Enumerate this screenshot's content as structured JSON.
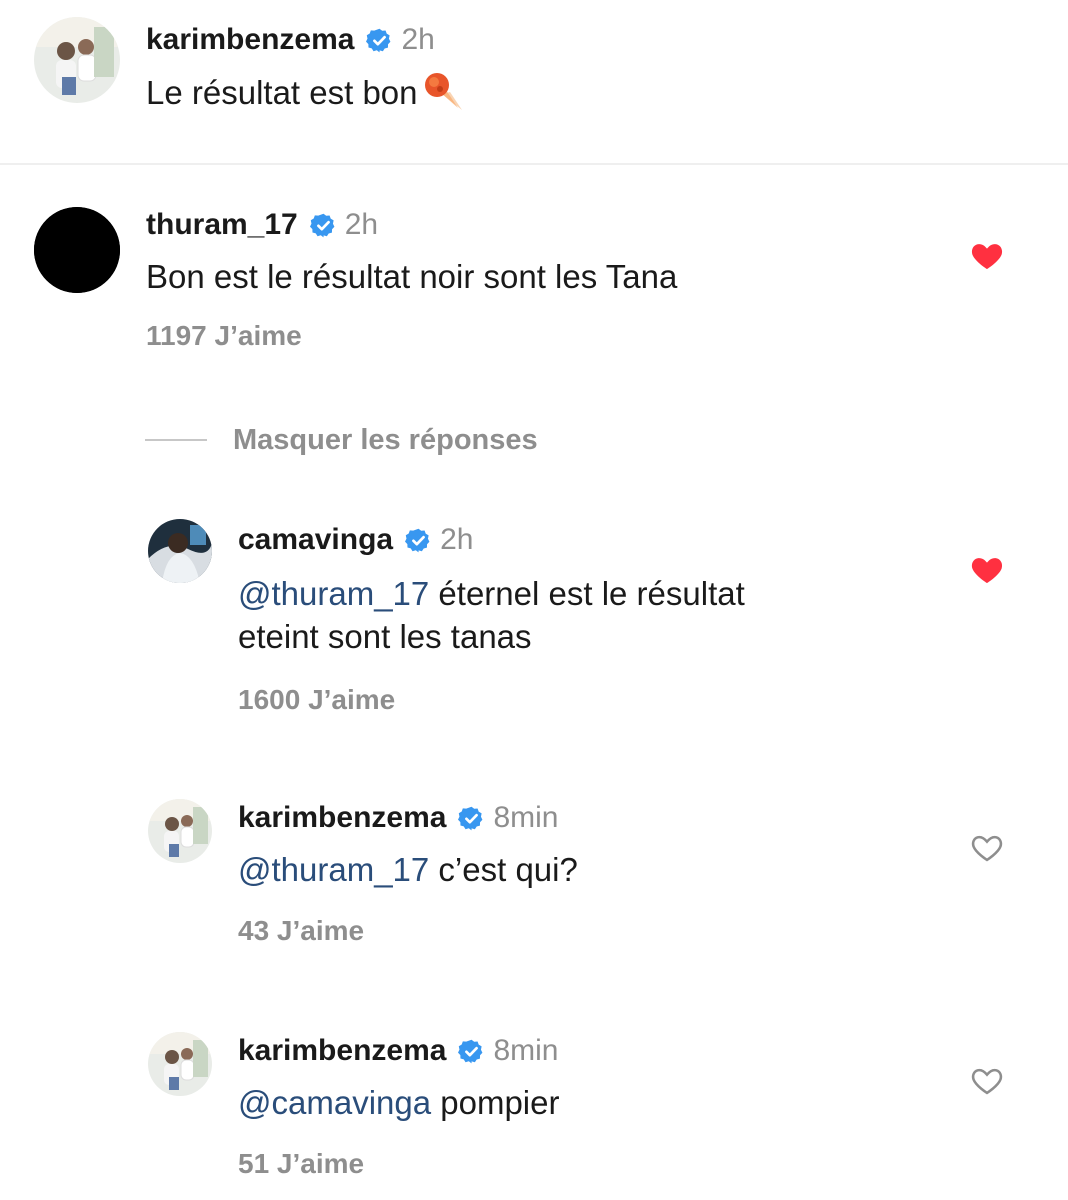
{
  "comments": [
    {
      "username": "karimbenzema",
      "time": "2h",
      "text": "Le résultat est bon",
      "emoji": "meteor-emoji"
    },
    {
      "username": "thuram_17",
      "time": "2h",
      "text": "Bon est le résultat noir sont les Tana",
      "likes": "1197 J’aime",
      "liked": true
    }
  ],
  "replies_toggle": "Masquer les réponses",
  "replies": [
    {
      "username": "camavinga",
      "time": "2h",
      "mention": "@thuram_17",
      "text": " éternel est le résultat",
      "text_line2": "eteint sont les tanas",
      "likes": "1600 J’aime",
      "liked": true
    },
    {
      "username": "karimbenzema",
      "time": "8min",
      "mention": "@thuram_17",
      "text": " c’est qui?",
      "likes": "43 J’aime",
      "liked": false
    },
    {
      "username": "karimbenzema",
      "time": "8min",
      "mention": "@camavinga",
      "text": " pompier",
      "likes": "51 J’aime",
      "liked": false
    }
  ],
  "colors": {
    "heart_liked": "#ff3040",
    "verified": "#3897f0",
    "mention": "#2a4d7a",
    "muted": "#8e8e8e"
  }
}
